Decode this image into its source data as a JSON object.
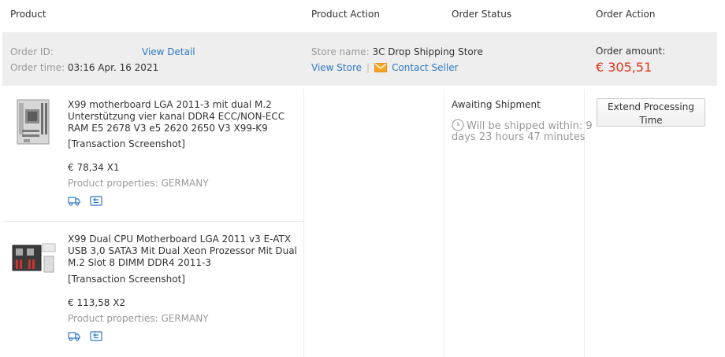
{
  "header": {
    "product": "Product",
    "product_action": "Product Action",
    "order_status": "Order Status",
    "order_action": "Order Action"
  },
  "order": {
    "id_label": "Order ID:",
    "view_detail": "View Detail",
    "time_label": "Order time:",
    "time_value": "03:16 Apr. 16 2021",
    "store_label": "Store name:",
    "store_value": "3C Drop Shipping Store",
    "view_store": "View Store",
    "separator": "|",
    "contact_seller": "Contact Seller",
    "amount_label": "Order amount:",
    "amount_value": "€ 305,51"
  },
  "items": [
    {
      "title": "X99 motherboard LGA 2011-3 mit dual M.2 Unterstützung vier kanal DDR4 ECC/NON-ECC RAM E5 2678 V3 e5 2620 2650 V3 X99-K9",
      "screenshot_link": "[Transaction Screenshot]",
      "price": "€ 78,34 X1",
      "properties": "Product properties: GERMANY"
    },
    {
      "title": "X99 Dual CPU Motherboard LGA 2011 v3 E-ATX USB 3,0 SATA3 Mit Dual Xeon Prozessor Mit Dual M.2 Slot 8 DIMM DDR4 2011-3",
      "screenshot_link": "[Transaction Screenshot]",
      "price": "€ 113,58 X2",
      "properties": "Product properties: GERMANY"
    }
  ],
  "status": {
    "text": "Awaiting Shipment",
    "ship_line1": "Will be shipped within: 9",
    "ship_line2": "days 23 hours 47 minutes"
  },
  "action": {
    "extend_line1": "Extend Processing",
    "extend_line2": "Time"
  },
  "icons": {
    "clock": "clock-icon",
    "mail": "mail-icon",
    "shipping": "shipping-icon",
    "exchange": "exchange-icon"
  },
  "colors": {
    "link": "#2f77c9",
    "amount": "#e0341a",
    "mail_icon": "#f5a623"
  }
}
